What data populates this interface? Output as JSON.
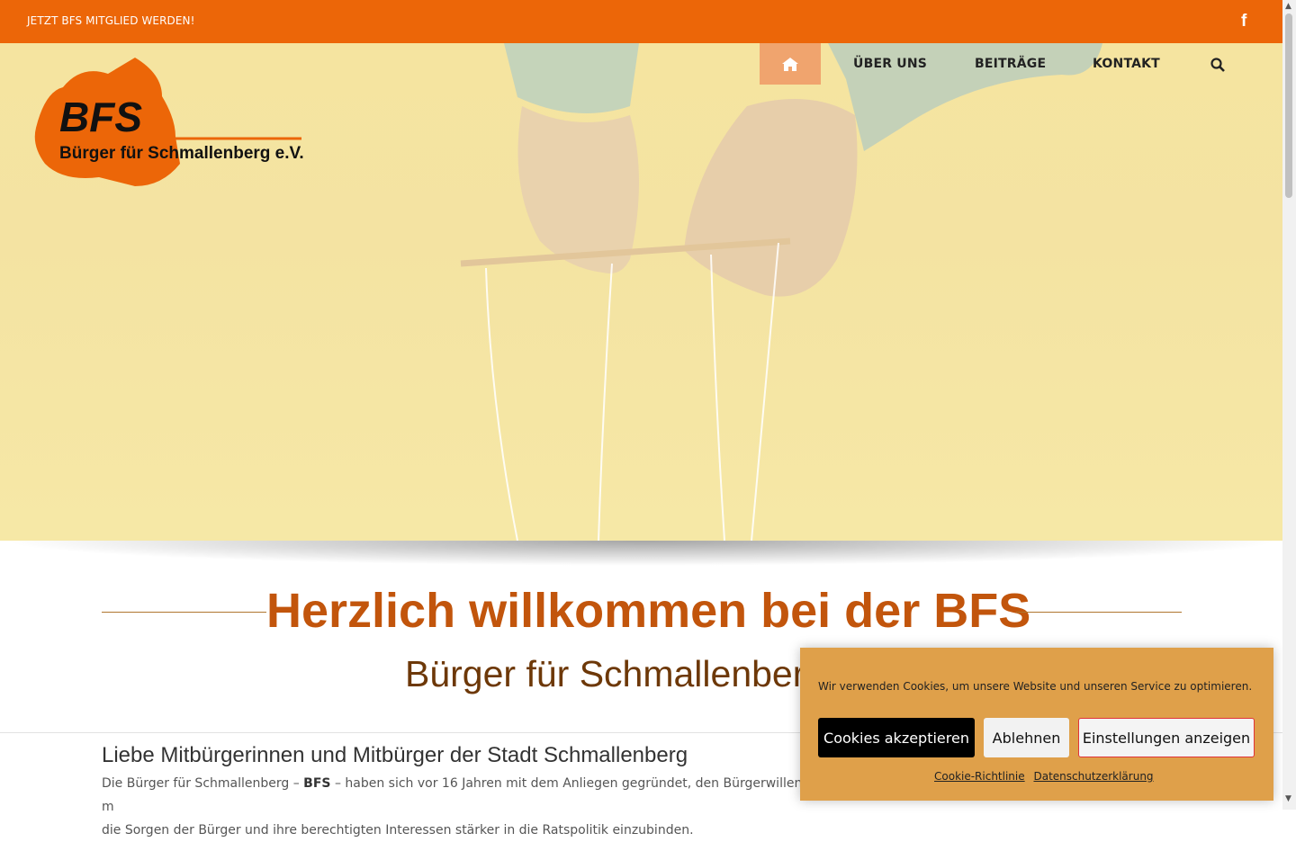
{
  "topbar": {
    "join_link": "JETZT BFS MITGLIED WERDEN!",
    "social_icon": "facebook-icon"
  },
  "logo": {
    "acronym": "BFS",
    "name": "Bürger für Schmallenberg e.V.",
    "color": "#ec6608"
  },
  "nav": {
    "home_icon": "home-icon",
    "items": [
      "ÜBER UNS",
      "BEITRÄGE",
      "KONTAKT"
    ],
    "search_icon": "search-icon"
  },
  "welcome": {
    "title": "Herzlich willkommen bei der BFS",
    "subtitle": "Bürger für Schmallenberg"
  },
  "content": {
    "heading": "Liebe Mitbürgerinnen und Mitbürger der Stadt Schmallenberg",
    "para_intro": "Die Bürger für Schmallenberg – ",
    "para_bold": "BFS",
    "para_rest": " – haben sich vor 16 Jahren mit dem Anliegen gegründet, den Bürgerwillen m",
    "para_line2": "die Sorgen der Bürger und ihre berechtigten Interessen stärker in die Ratspolitik einzubinden."
  },
  "cookie_banner": {
    "message": "Wir verwenden Cookies, um unsere Website und unseren Service zu optimieren.",
    "accept": "Cookies akzeptieren",
    "deny": "Ablehnen",
    "settings": "Einstellungen anzeigen",
    "policy_link": "Cookie-Richtlinie",
    "privacy_link": "Datenschutzerklärung"
  },
  "colors": {
    "brand_orange": "#ec6608",
    "title_orange": "#c2550c",
    "subtitle_brown": "#6d3808",
    "cookie_bg": "#dfa04a"
  }
}
